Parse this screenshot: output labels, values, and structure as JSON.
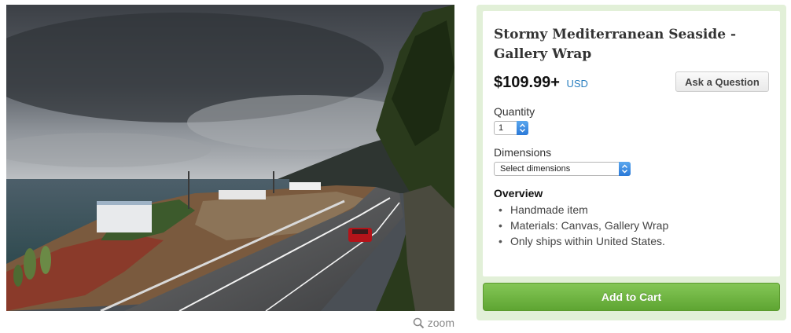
{
  "listing": {
    "title": "Stormy Mediterranean Seaside - Gallery Wrap",
    "price": "$109.99+",
    "currency": "USD",
    "ask_label": "Ask a Question"
  },
  "quantity": {
    "label": "Quantity",
    "value": "1"
  },
  "dimensions": {
    "label": "Dimensions",
    "value": "Select dimensions"
  },
  "overview": {
    "heading": "Overview",
    "items": [
      "Handmade item",
      "Materials: Canvas, Gallery Wrap",
      "Only ships within United States."
    ]
  },
  "cart": {
    "label": "Add to Cart"
  },
  "zoom": {
    "label": "zoom"
  },
  "colors": {
    "buybox_bg": "#e2f0d8",
    "cart_button": "#6bb23e",
    "currency_link": "#2a7fc0",
    "select_arrow": "#3d8de3"
  },
  "icons": {
    "zoom": "magnifier-icon",
    "select": "updown-arrows-icon"
  }
}
